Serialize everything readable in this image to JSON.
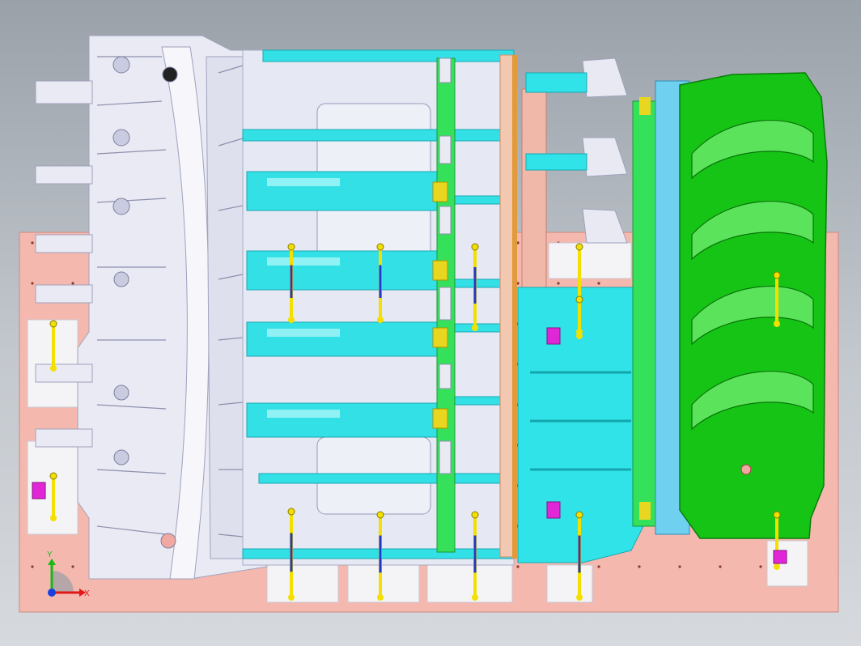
{
  "viewport": {
    "background_top": "#9aa1a9",
    "background_bottom": "#d6d9dd"
  },
  "fixture_plate": {
    "color": "#f4b8ae",
    "hole_color": "#8a3a30"
  },
  "parts": {
    "front_structure": {
      "color": "#e9eaf4",
      "edge": "#9fa2bd"
    },
    "crossmembers": {
      "color": "#33e0e6",
      "edge": "#1aa8b3"
    },
    "floor_panel_cyan": {
      "color": "#2fe3e8"
    },
    "longitudinal_rails": {
      "color": "#35e05a"
    },
    "rear_floor_pan": {
      "color": "#16c416",
      "edge": "#0a7d0a"
    },
    "seam_strip": {
      "color": "#f2c9b0"
    },
    "orange_seam": {
      "color": "#e39a3a"
    }
  },
  "clamps": {
    "pin_yellow": "#f3e000",
    "pin_blue": "#2337c8",
    "marker_magenta": "#e026d6"
  },
  "triad": {
    "x_label": "X",
    "y_label": "Y",
    "x_color": "#e01818",
    "y_color": "#18b818",
    "z_color": "#1840e0"
  }
}
